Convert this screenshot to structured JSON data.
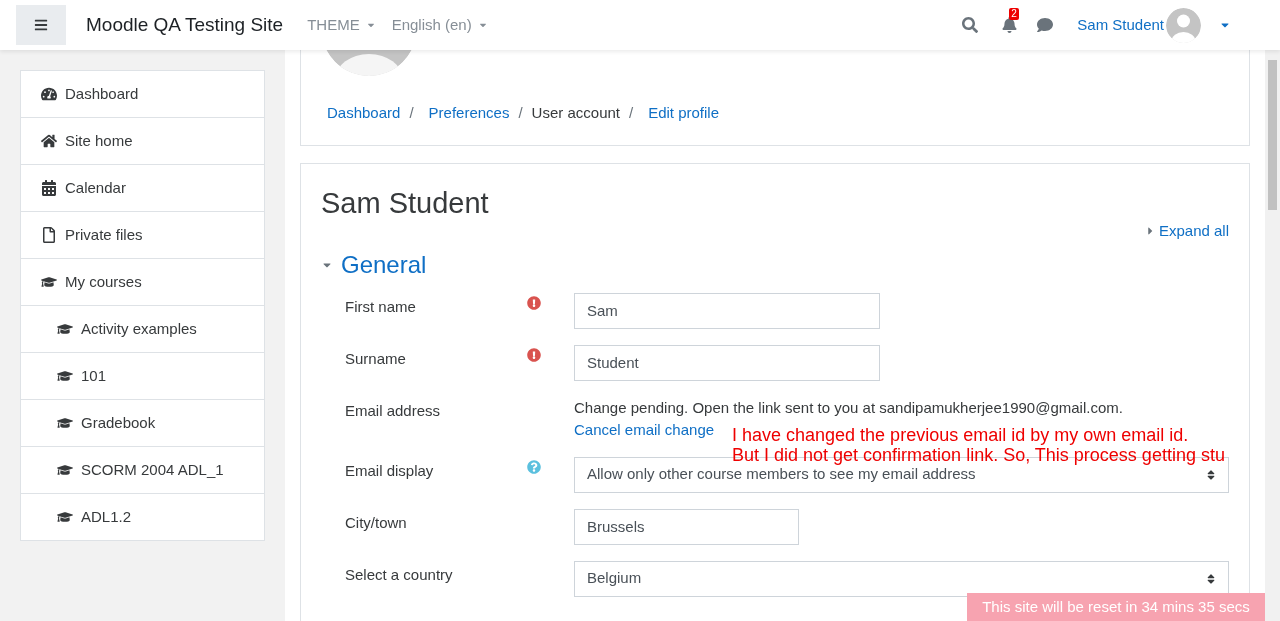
{
  "navbar": {
    "site_name": "Moodle QA Testing Site",
    "menus": [
      "THEME",
      "English (en)"
    ],
    "notification_count": "2",
    "user_name": "Sam Student"
  },
  "sidebar": {
    "items": [
      {
        "label": "Dashboard"
      },
      {
        "label": "Site home"
      },
      {
        "label": "Calendar"
      },
      {
        "label": "Private files"
      },
      {
        "label": "My courses",
        "children": [
          {
            "label": "Activity examples"
          },
          {
            "label": "101"
          },
          {
            "label": "Gradebook"
          },
          {
            "label": "SCORM 2004 ADL_1"
          },
          {
            "label": "ADL1.2"
          }
        ]
      }
    ]
  },
  "breadcrumb": {
    "separator": "/",
    "items": [
      {
        "label": "Dashboard",
        "link": true
      },
      {
        "label": "Preferences",
        "link": true
      },
      {
        "label": "User account",
        "link": false
      },
      {
        "label": "Edit profile",
        "link": true
      }
    ]
  },
  "page_title": "Sam Student",
  "expand_all": "Expand all",
  "section": {
    "title": "General",
    "expanded": true
  },
  "fields": [
    {
      "kind": "text",
      "label": "First name",
      "required": true,
      "value": "Sam"
    },
    {
      "kind": "text",
      "label": "Surname",
      "required": true,
      "value": "Student"
    },
    {
      "kind": "static",
      "label": "Email address",
      "text": "Change pending. Open the link sent to you at sandipamukherjee1990@gmail.com.",
      "link": "Cancel email change"
    },
    {
      "kind": "select",
      "label": "Email display",
      "help": true,
      "value": "Allow only other course members to see my email address"
    },
    {
      "kind": "short",
      "label": "City/town",
      "value": "Brussels"
    },
    {
      "kind": "select",
      "label": "Select a country",
      "value": "Belgium"
    }
  ],
  "annotation": [
    "I have changed the previous email id by my own email id.",
    "But I did not get confirmation link. So, This process getting stu"
  ],
  "reset_notice": "This site will be reset in 34 mins 35 secs"
}
